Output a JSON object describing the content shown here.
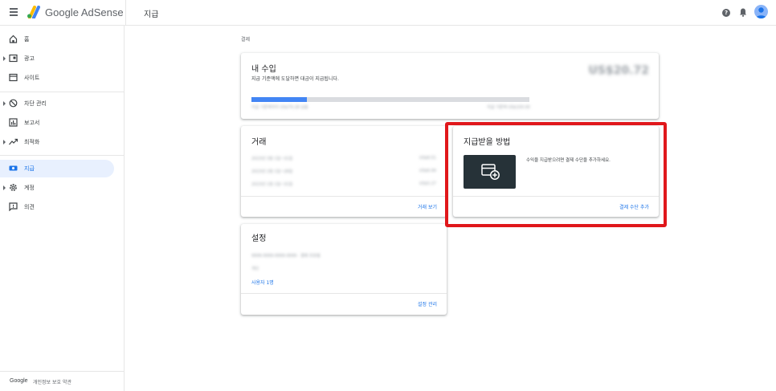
{
  "header": {
    "brand": "Google AdSense",
    "page_title": "지급",
    "help_icon": "?"
  },
  "sidebar": {
    "items": [
      {
        "label": "홈",
        "icon": "home-icon"
      },
      {
        "label": "광고",
        "icon": "ads-icon"
      },
      {
        "label": "사이트",
        "icon": "sites-icon"
      },
      {
        "label": "차단 관리",
        "icon": "block-icon"
      },
      {
        "label": "보고서",
        "icon": "reports-icon"
      },
      {
        "label": "최적화",
        "icon": "optimize-icon"
      },
      {
        "label": "지급",
        "icon": "payments-icon"
      },
      {
        "label": "계정",
        "icon": "settings-icon"
      },
      {
        "label": "의견",
        "icon": "feedback-icon"
      }
    ],
    "footer": {
      "google": "Google",
      "links": "개인정보 보호  약관"
    }
  },
  "main": {
    "breadcrumb": "결제",
    "earnings": {
      "title": "내 수입",
      "subtitle": "지급 기준액에 도달하면 대금이 지급됩니다.",
      "amount": "US$20.72",
      "progress": 0.2,
      "progress_label_left": "지급 기준액까지 US$79.28 남음",
      "progress_label_right": "지급 기준액 US$100.00"
    },
    "transactions": {
      "title": "거래",
      "rows": [
        {
          "left": "2023년 3월 1일~31일",
          "right": "US$8.51"
        },
        {
          "left": "2023년 2월 1일~28일",
          "right": "US$6.94"
        },
        {
          "left": "2023년 1월 1일~31일",
          "right": "US$5.27"
        }
      ],
      "action": "거래 보기"
    },
    "payment_method": {
      "title": "지급받을 방법",
      "description": "수익을 지급받으려면 결제 수단을 추가하세요.",
      "action": "결제 수단 추가",
      "icon": "add-payment-card-icon"
    },
    "settings": {
      "title": "설정",
      "line1": "9999-9999-9999-9999 · 결제 프로필",
      "line2": "개인",
      "users": "사용자 1명",
      "action": "설정 관리"
    }
  },
  "colors": {
    "accent": "#1a73e8",
    "active_bg": "#e8f0fe",
    "highlight": "#e0171b",
    "progress": "#4285f4",
    "pay_button": "#263238"
  }
}
